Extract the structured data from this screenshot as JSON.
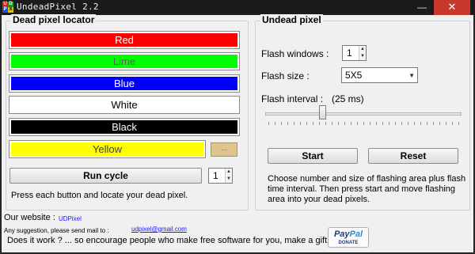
{
  "window": {
    "title": "UndeadPixel 2.2",
    "icon_letters": [
      "U",
      "D",
      "P",
      "X"
    ],
    "minimize_glyph": "—",
    "close_glyph": "✕"
  },
  "left_panel": {
    "title": "Dead pixel locator",
    "color_buttons": [
      {
        "label": "Red",
        "color": "#ff0000"
      },
      {
        "label": "Lime",
        "color": "#00ff00"
      },
      {
        "label": "Blue",
        "color": "#0000ff"
      },
      {
        "label": "White",
        "color": "#ffffff"
      },
      {
        "label": "Black",
        "color": "#000000"
      },
      {
        "label": "Yellow",
        "color": "#ffff00"
      }
    ],
    "custom_color_label": "...",
    "run_cycle_label": "Run cycle",
    "cycle_count": "1",
    "hint": "Press each button and locate your dead pixel."
  },
  "right_panel": {
    "title": "Undead pixel",
    "flash_windows_label": "Flash windows :",
    "flash_windows_value": "1",
    "flash_size_label": "Flash size :",
    "flash_size_value": "5X5",
    "flash_interval_label": "Flash interval :",
    "flash_interval_value": "(25 ms)",
    "start_label": "Start",
    "reset_label": "Reset",
    "hint": "Choose number and size of flashing area plus flash time interval. Then press start and move flashing area into your dead pixels."
  },
  "footer": {
    "website_label": "Our website :",
    "website_link": "UDPixel",
    "mail_label": "Any suggestion, please send mail to :",
    "mail_link": "udpixel@gmail.com",
    "gift_text": "Does it work ? ... so encourage people who make free software for you, make a gift :",
    "paypal_pay": "Pay",
    "paypal_pal": "Pal",
    "paypal_donate": "DONATE"
  }
}
